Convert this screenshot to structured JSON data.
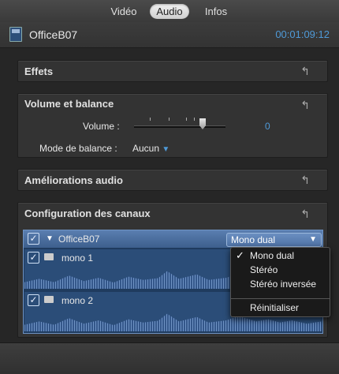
{
  "tabs": [
    {
      "label": "Vidéo",
      "active": false
    },
    {
      "label": "Audio",
      "active": true
    },
    {
      "label": "Infos",
      "active": false
    }
  ],
  "header": {
    "clip_name": "OfficeB07",
    "timecode": "00:01:09:12"
  },
  "sections": {
    "effects": {
      "title": "Effets"
    },
    "volume": {
      "title": "Volume et balance",
      "volume_label": "Volume :",
      "volume_value": "0",
      "balance_label": "Mode de balance :",
      "balance_value": "Aucun"
    },
    "enhancements": {
      "title": "Améliorations audio"
    },
    "channels": {
      "title": "Configuration des canaux"
    }
  },
  "channel_config": {
    "clip": "OfficeB07",
    "mode": "Mono dual",
    "lanes": [
      {
        "label": "mono 1",
        "checked": true
      },
      {
        "label": "mono 2",
        "checked": true
      }
    ]
  },
  "mode_menu": {
    "items": [
      "Mono dual",
      "Stéréo",
      "Stéréo inversée"
    ],
    "selected": "Mono dual",
    "reset": "Réinitialiser"
  },
  "colors": {
    "accent": "#4f9ad8",
    "selection": "#3d5f8d"
  }
}
